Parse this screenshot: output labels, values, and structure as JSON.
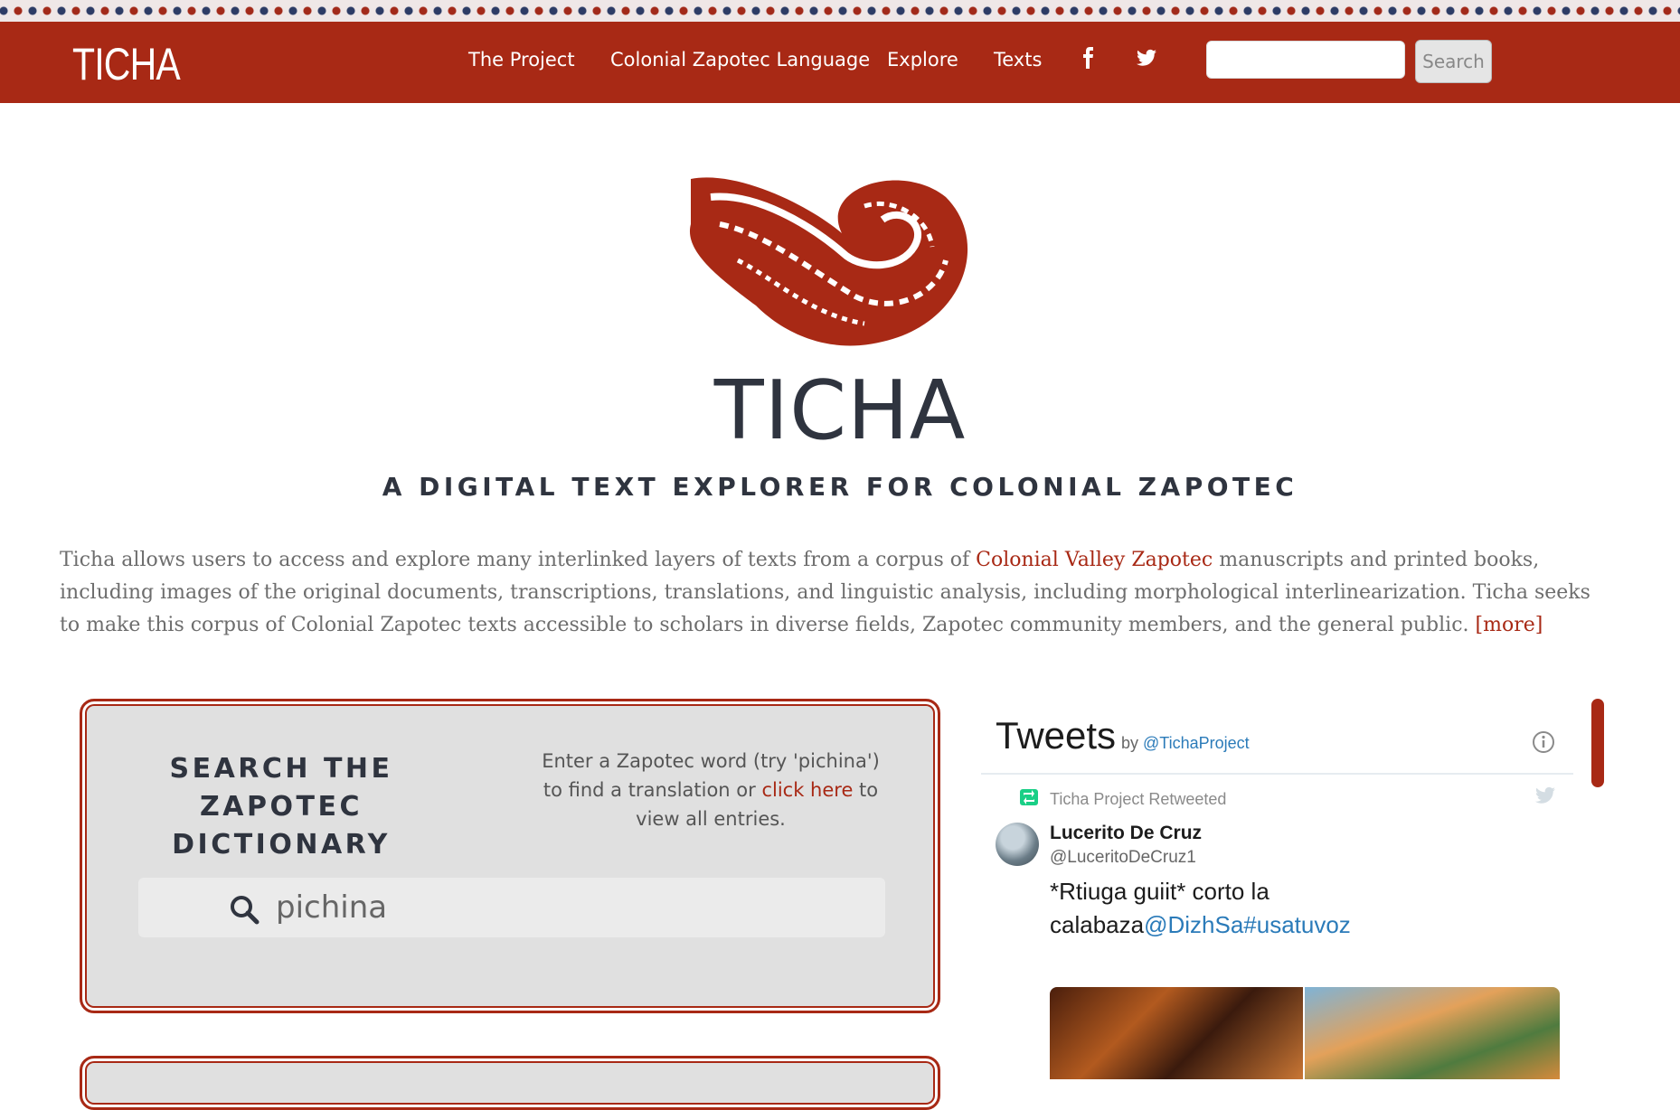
{
  "nav": {
    "brand": "TICHA",
    "links": [
      "The Project",
      "Colonial Zapotec Language",
      "Explore",
      "Texts"
    ],
    "icons": [
      "facebook-icon",
      "twitter-icon"
    ],
    "search_placeholder": "",
    "search_button": "Search"
  },
  "hero": {
    "title": "TICHA",
    "subtitle": "A DIGITAL TEXT EXPLORER FOR COLONIAL ZAPOTEC"
  },
  "intro": {
    "text_before": "Ticha allows users to access and explore many interlinked layers of texts from a corpus of ",
    "link": "Colonial Valley Zapotec",
    "text_after": " manuscripts and printed books, including images of the original documents, transcriptions, translations, and linguistic analysis, including morphological interlinearization. Ticha seeks to make this corpus of Colonial Zapotec texts accessible to scholars in diverse fields, Zapotec community members, and the general public. ",
    "more": "[more]"
  },
  "dictionary": {
    "heading": "SEARCH THE ZAPOTEC DICTIONARY",
    "help_before": "Enter a Zapotec word (try 'pichina') to find a translation or ",
    "help_link": "click here",
    "help_after": " to view all entries.",
    "search_value": "pichina"
  },
  "tweets": {
    "title": "Tweets",
    "by": "by ",
    "account": "@TichaProject",
    "retweet_label": "Ticha Project Retweeted",
    "author_name": "Lucerito De Cruz",
    "author_handle": "@LuceritoDeCruz1",
    "text_plain": "*Rtiuga guiit* corto la calabaza",
    "text_links": "@DizhSa#usatuvoz"
  },
  "colors": {
    "brand_red": "#a82915",
    "dark_text": "#2f343f",
    "link_blue": "#2b7bb9"
  }
}
